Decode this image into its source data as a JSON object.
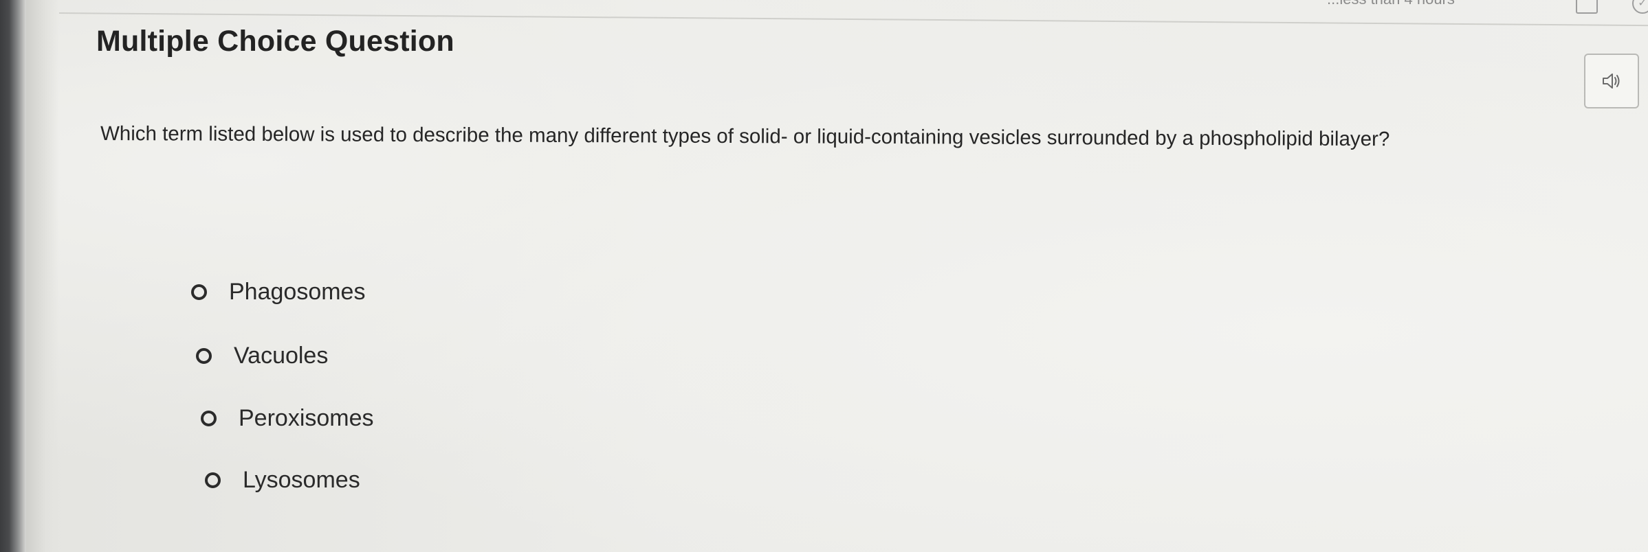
{
  "page": {
    "title": "Multiple Choice Question",
    "question": "Which term listed below is used to describe the many different types of solid- or liquid-containing vesicles surrounded by a phospholipid bilayer?",
    "top_status_partial": "...less than 4 hours"
  },
  "audio_button": {
    "icon": "speaker-icon"
  },
  "choices": [
    {
      "label": "Phagosomes",
      "selected": false
    },
    {
      "label": "Vacuoles",
      "selected": false
    },
    {
      "label": "Peroxisomes",
      "selected": false
    },
    {
      "label": "Lysosomes",
      "selected": false
    }
  ],
  "colors": {
    "background": "#ecece9",
    "text": "#262626",
    "radio_border": "#2b2b2b"
  }
}
